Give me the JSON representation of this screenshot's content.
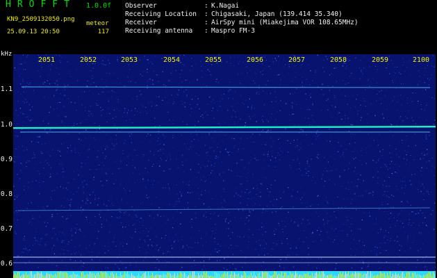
{
  "header": {
    "app_title": "HROFFT",
    "version": "1.0.0f",
    "filename": "KN9_2509132050.png",
    "mode": "meteor",
    "timestamp": "25.09.13 20:50",
    "count": "117"
  },
  "info": [
    {
      "label": "Observer",
      "value": "K.Nagai"
    },
    {
      "label": "Receiving Location",
      "value": "Chigasaki, Japan (139.414 35.340)"
    },
    {
      "label": "Receiver",
      "value": "AirSpy mini (Miakejima VOR 108.65MHz)"
    },
    {
      "label": "Receiving antenna",
      "value": "Maspro FM-3"
    }
  ],
  "spectrogram": {
    "y_unit": "kHz",
    "y_ticks": [
      "1.1",
      "1.0",
      "0.9",
      "0.8",
      "0.7",
      "0.6"
    ],
    "x_ticks": [
      "2051",
      "2052",
      "2053",
      "2054",
      "2055",
      "2056",
      "2057",
      "2058",
      "2059",
      "2100"
    ],
    "background_color": "#07136e",
    "trace_color": "#55e0ff",
    "carrier_color": "#00ffb0"
  }
}
